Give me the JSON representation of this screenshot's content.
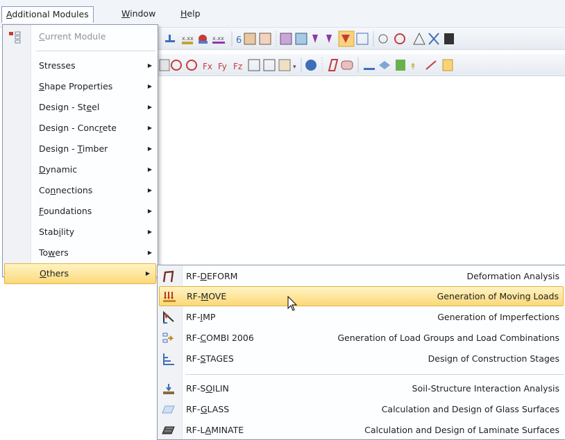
{
  "menubar": {
    "items": [
      {
        "pre": "",
        "u": "A",
        "post": "dditional Modules"
      },
      {
        "pre": "",
        "u": "W",
        "post": "indow"
      },
      {
        "pre": "",
        "u": "H",
        "post": "elp"
      }
    ]
  },
  "main_menu": {
    "current_module": {
      "pre": "",
      "u": "C",
      "post": "urrent Module"
    },
    "items": [
      {
        "pre": "Stresses",
        "u": "",
        "post": ""
      },
      {
        "pre": "",
        "u": "S",
        "post": "hape Properties"
      },
      {
        "pre": "Design - St",
        "u": "e",
        "post": "el"
      },
      {
        "pre": "Design - Conc",
        "u": "r",
        "post": "ete"
      },
      {
        "pre": "Design - ",
        "u": "T",
        "post": "imber"
      },
      {
        "pre": "",
        "u": "D",
        "post": "ynamic"
      },
      {
        "pre": "Co",
        "u": "n",
        "post": "nections"
      },
      {
        "pre": "",
        "u": "F",
        "post": "oundations"
      },
      {
        "pre": "Stab",
        "u": "i",
        "post": "lity"
      },
      {
        "pre": "To",
        "u": "w",
        "post": "ers"
      },
      {
        "pre": "",
        "u": "O",
        "post": "thers"
      }
    ]
  },
  "others_submenu": {
    "items": [
      {
        "pre": "RF-",
        "u": "D",
        "post": "EFORM",
        "desc": "Deformation Analysis",
        "icon_color": "#b0392b"
      },
      {
        "pre": "RF-",
        "u": "M",
        "post": "OVE",
        "desc": "Generation of Moving Loads",
        "icon_color": "#c9891f"
      },
      {
        "pre": "RF-",
        "u": "I",
        "post": "MP",
        "desc": "Generation of Imperfections",
        "icon_color": "#b0392b"
      },
      {
        "pre": "RF-",
        "u": "C",
        "post": "OMBI 2006",
        "desc": "Generation of Load Groups and Load Combinations",
        "icon_color": "#3d6fb8"
      },
      {
        "pre": "RF-",
        "u": "S",
        "post": "TAGES",
        "desc": "Design of Construction Stages",
        "icon_color": "#3d6fb8"
      },
      {
        "pre": "RF-S",
        "u": "O",
        "post": "ILIN",
        "desc": "Soil-Structure Interaction Analysis",
        "icon_color": "#8a6b3b"
      },
      {
        "pre": "RF-",
        "u": "G",
        "post": "LASS",
        "desc": "Calculation and Design of Glass Surfaces",
        "icon_color": "#7fa6d4"
      },
      {
        "pre": "RF-L",
        "u": "A",
        "post": "MINATE",
        "desc": "Calculation and Design of Laminate Surfaces",
        "icon_color": "#4a4a4a"
      }
    ]
  },
  "colors": {
    "highlight": "#fbd97a",
    "menu_border": "#8a97a9"
  }
}
